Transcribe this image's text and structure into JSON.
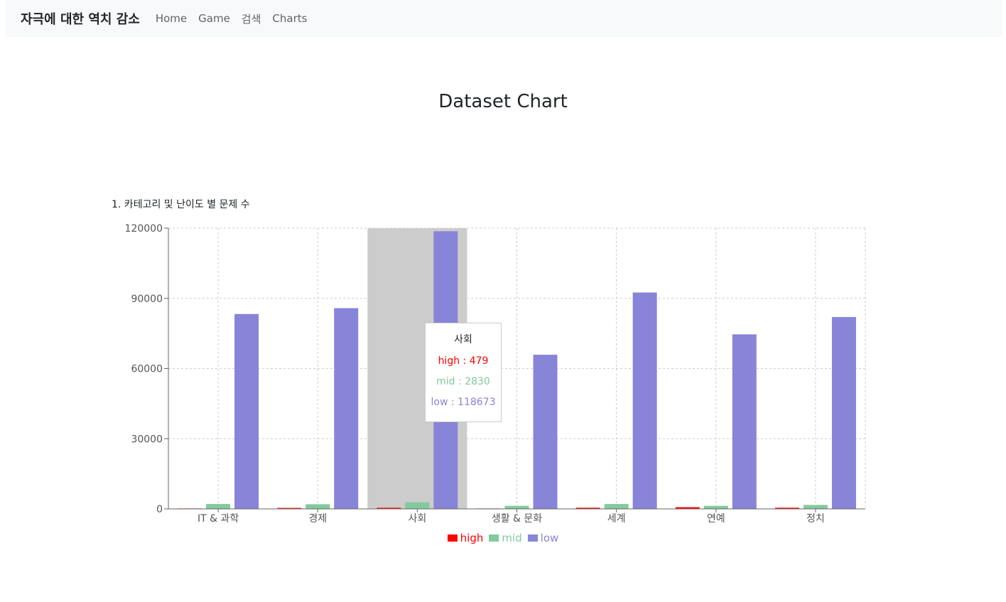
{
  "navbar": {
    "brand": "자극에 대한 역치 감소",
    "links": [
      "Home",
      "Game",
      "검색",
      "Charts"
    ]
  },
  "page": {
    "title": "Dataset Chart",
    "subtitle": "1. 카테고리 및 난이도 별 문제 수"
  },
  "colors": {
    "high": "#ff0000",
    "mid": "#82ca9d",
    "low": "#8884d8",
    "highlight": "#cccccc"
  },
  "chart_data": {
    "type": "bar",
    "title": "1. 카테고리 및 난이도 별 문제 수",
    "xlabel": "",
    "ylabel": "",
    "categories": [
      "IT & 과학",
      "경제",
      "사회",
      "생활 & 문화",
      "세계",
      "연예",
      "정치"
    ],
    "series": [
      {
        "name": "high",
        "values": [
          200,
          420,
          479,
          190,
          500,
          730,
          500
        ]
      },
      {
        "name": "mid",
        "values": [
          2100,
          2000,
          2830,
          1300,
          2100,
          1300,
          1700
        ]
      },
      {
        "name": "low",
        "values": [
          83300,
          85800,
          118673,
          65900,
          92500,
          74600,
          82000
        ]
      }
    ],
    "ylim": [
      0,
      120000
    ],
    "yticks": [
      "0",
      "30000",
      "60000",
      "90000",
      "120000"
    ],
    "grid": true,
    "legend": "bottom-center",
    "active_category": "사회",
    "tooltip": {
      "title": "사회",
      "high_label": "high : 479",
      "mid_label": "mid : 2830",
      "low_label": "low : 118673"
    }
  }
}
